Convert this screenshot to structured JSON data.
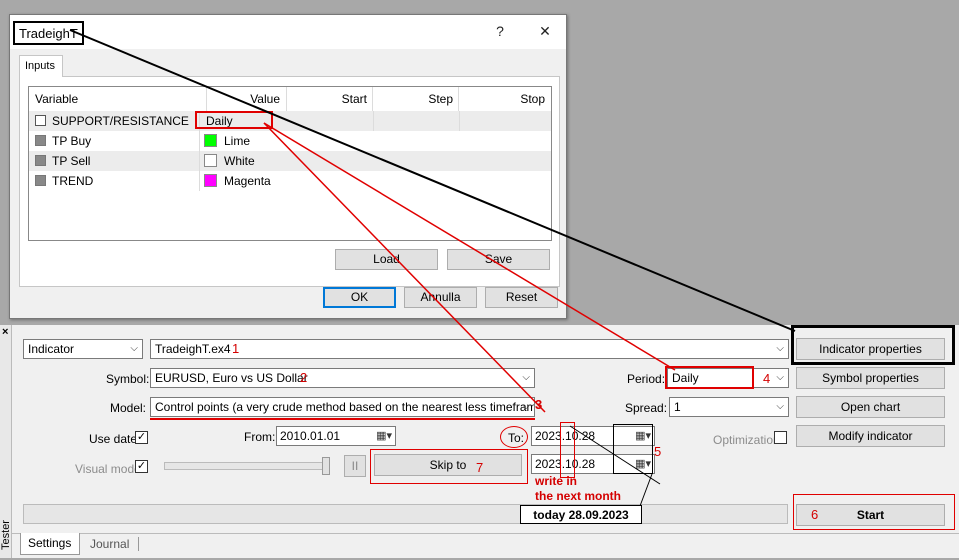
{
  "dialog": {
    "title": "TradeighT",
    "help_glyph": "?",
    "close_glyph": "✕",
    "tab": "Inputs",
    "columns": [
      "Variable",
      "Value",
      "Start",
      "Step",
      "Stop"
    ],
    "rows": [
      {
        "variable": "SUPPORT/RESISTANCE",
        "value": "Daily"
      },
      {
        "variable": "TP Buy",
        "value": "Lime",
        "color": "#00ff00"
      },
      {
        "variable": "TP Sell",
        "value": "White",
        "color": "#ffffff"
      },
      {
        "variable": "TREND",
        "value": "Magenta",
        "color": "#ff00ff"
      }
    ],
    "load_button": "Load",
    "save_button": "Save",
    "ok_button": "OK",
    "cancel_button": "Annulla",
    "reset_button": "Reset"
  },
  "tester": {
    "side_tab": "Tester",
    "type_select": "Indicator",
    "expert_select": "TradeighT.ex4",
    "symbol_label": "Symbol:",
    "symbol_value": "EURUSD, Euro vs US Dollar",
    "model_label": "Model:",
    "model_value": "Control points (a very crude method based on the nearest less timeframe, the",
    "use_date_label": "Use date",
    "from_label": "From:",
    "from_value": "2010.01.01",
    "to_label": "To:",
    "to_value_1": "2023.10.28",
    "to_value_2": "2023.10.28",
    "visual_mode_label": "Visual mode",
    "pause_glyph": "II",
    "skip_to_button": "Skip to",
    "period_label": "Period:",
    "period_value": "Daily",
    "spread_label": "Spread:",
    "spread_value": "1",
    "optimization_label": "Optimization",
    "indicator_properties_button": "Indicator properties",
    "symbol_properties_button": "Symbol properties",
    "open_chart_button": "Open chart",
    "modify_indicator_button": "Modify indicator",
    "start_button": "Start",
    "tabs": [
      "Settings",
      "Journal"
    ]
  },
  "annotations": {
    "n1": "1",
    "n2": "2",
    "n3": "3",
    "n4": "4",
    "n5": "5",
    "n6": "6",
    "n7": "7",
    "write_note_1": "write in",
    "write_note_2": "the next month",
    "today_note": "today 28.09.2023"
  },
  "colors": {
    "annotation_red": "#d40000",
    "progress_bg": "#e6e6e6",
    "accent_blue": "#0078d7"
  }
}
